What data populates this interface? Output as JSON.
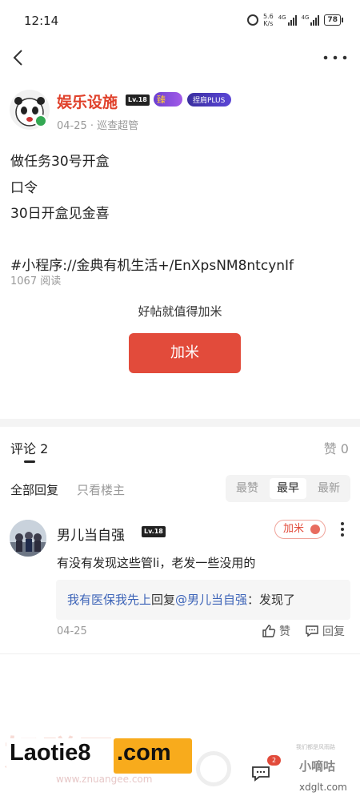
{
  "status_bar": {
    "time": "12:14",
    "net_speed_value": "5.6",
    "net_speed_unit": "K/s",
    "signal_1_label": "4G",
    "signal_2_label": "4G",
    "battery": "78"
  },
  "post": {
    "author_name": "娱乐设施",
    "author_level": "Lv.18",
    "badge_fire_label": "臻",
    "badge_plus_label": "捏肩PLUS",
    "post_date": "04-25",
    "post_role": "· 巡查超管",
    "content": "做任务30号开盒\n口令\n30日开盒见金喜\n\n#小程序://金典有机生活+/EnXpsNM8ntcynIf",
    "read_count": "1067 阅读",
    "reward_prompt": "好帖就值得加米",
    "reward_button": "加米"
  },
  "comments_header": {
    "tab_comments": "评论 2",
    "tab_likes": "赞 0",
    "filter_all": "全部回复",
    "filter_op": "只看楼主",
    "sort_options": [
      "最赞",
      "最早",
      "最新"
    ],
    "sort_selected": "最早"
  },
  "comment": {
    "user_name": "男儿当自强",
    "user_level": "Lv.18",
    "reward_label": "加米",
    "text": "有没有发现这些管li，老发一些没用的",
    "reply_author": "我有医保我先上",
    "reply_verb": "回复",
    "reply_target": "@男儿当自强",
    "reply_text": "：发现了",
    "date": "04-25",
    "like_label": "赞",
    "reply_label": "回复"
  },
  "bottom": {
    "watermark_main": "Laotie8",
    "watermark_com": ".com",
    "watermark_faint": "好赚网",
    "watermark_url": "www.zhuangee.com",
    "chat_badge": "2",
    "watermark_right_small": "我们都是风雨路",
    "watermark_right_cn": "小嘀咕",
    "watermark_right_url": "xdglt.com"
  },
  "colors": {
    "accent": "#e24b3b",
    "author_name": "#e0412b",
    "link_blue": "#3d64b8"
  }
}
